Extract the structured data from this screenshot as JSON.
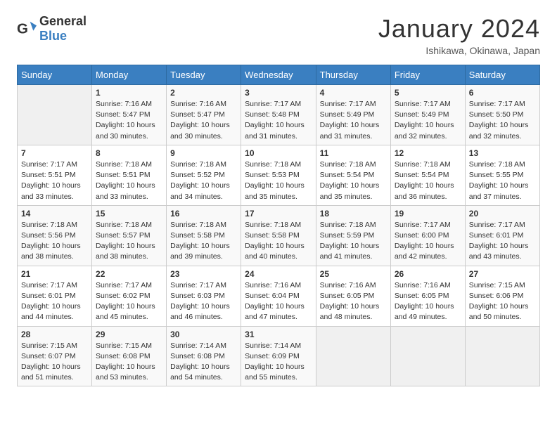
{
  "header": {
    "logo": {
      "general": "General",
      "blue": "Blue"
    },
    "title": "January 2024",
    "location": "Ishikawa, Okinawa, Japan"
  },
  "weekdays": [
    "Sunday",
    "Monday",
    "Tuesday",
    "Wednesday",
    "Thursday",
    "Friday",
    "Saturday"
  ],
  "weeks": [
    [
      {
        "day": null
      },
      {
        "day": "1",
        "sunrise": "7:16 AM",
        "sunset": "5:47 PM",
        "daylight": "10 hours and 30 minutes."
      },
      {
        "day": "2",
        "sunrise": "7:16 AM",
        "sunset": "5:47 PM",
        "daylight": "10 hours and 30 minutes."
      },
      {
        "day": "3",
        "sunrise": "7:17 AM",
        "sunset": "5:48 PM",
        "daylight": "10 hours and 31 minutes."
      },
      {
        "day": "4",
        "sunrise": "7:17 AM",
        "sunset": "5:49 PM",
        "daylight": "10 hours and 31 minutes."
      },
      {
        "day": "5",
        "sunrise": "7:17 AM",
        "sunset": "5:49 PM",
        "daylight": "10 hours and 32 minutes."
      },
      {
        "day": "6",
        "sunrise": "7:17 AM",
        "sunset": "5:50 PM",
        "daylight": "10 hours and 32 minutes."
      }
    ],
    [
      {
        "day": "7",
        "sunrise": "7:17 AM",
        "sunset": "5:51 PM",
        "daylight": "10 hours and 33 minutes."
      },
      {
        "day": "8",
        "sunrise": "7:18 AM",
        "sunset": "5:51 PM",
        "daylight": "10 hours and 33 minutes."
      },
      {
        "day": "9",
        "sunrise": "7:18 AM",
        "sunset": "5:52 PM",
        "daylight": "10 hours and 34 minutes."
      },
      {
        "day": "10",
        "sunrise": "7:18 AM",
        "sunset": "5:53 PM",
        "daylight": "10 hours and 35 minutes."
      },
      {
        "day": "11",
        "sunrise": "7:18 AM",
        "sunset": "5:54 PM",
        "daylight": "10 hours and 35 minutes."
      },
      {
        "day": "12",
        "sunrise": "7:18 AM",
        "sunset": "5:54 PM",
        "daylight": "10 hours and 36 minutes."
      },
      {
        "day": "13",
        "sunrise": "7:18 AM",
        "sunset": "5:55 PM",
        "daylight": "10 hours and 37 minutes."
      }
    ],
    [
      {
        "day": "14",
        "sunrise": "7:18 AM",
        "sunset": "5:56 PM",
        "daylight": "10 hours and 38 minutes."
      },
      {
        "day": "15",
        "sunrise": "7:18 AM",
        "sunset": "5:57 PM",
        "daylight": "10 hours and 38 minutes."
      },
      {
        "day": "16",
        "sunrise": "7:18 AM",
        "sunset": "5:58 PM",
        "daylight": "10 hours and 39 minutes."
      },
      {
        "day": "17",
        "sunrise": "7:18 AM",
        "sunset": "5:58 PM",
        "daylight": "10 hours and 40 minutes."
      },
      {
        "day": "18",
        "sunrise": "7:18 AM",
        "sunset": "5:59 PM",
        "daylight": "10 hours and 41 minutes."
      },
      {
        "day": "19",
        "sunrise": "7:17 AM",
        "sunset": "6:00 PM",
        "daylight": "10 hours and 42 minutes."
      },
      {
        "day": "20",
        "sunrise": "7:17 AM",
        "sunset": "6:01 PM",
        "daylight": "10 hours and 43 minutes."
      }
    ],
    [
      {
        "day": "21",
        "sunrise": "7:17 AM",
        "sunset": "6:01 PM",
        "daylight": "10 hours and 44 minutes."
      },
      {
        "day": "22",
        "sunrise": "7:17 AM",
        "sunset": "6:02 PM",
        "daylight": "10 hours and 45 minutes."
      },
      {
        "day": "23",
        "sunrise": "7:17 AM",
        "sunset": "6:03 PM",
        "daylight": "10 hours and 46 minutes."
      },
      {
        "day": "24",
        "sunrise": "7:16 AM",
        "sunset": "6:04 PM",
        "daylight": "10 hours and 47 minutes."
      },
      {
        "day": "25",
        "sunrise": "7:16 AM",
        "sunset": "6:05 PM",
        "daylight": "10 hours and 48 minutes."
      },
      {
        "day": "26",
        "sunrise": "7:16 AM",
        "sunset": "6:05 PM",
        "daylight": "10 hours and 49 minutes."
      },
      {
        "day": "27",
        "sunrise": "7:15 AM",
        "sunset": "6:06 PM",
        "daylight": "10 hours and 50 minutes."
      }
    ],
    [
      {
        "day": "28",
        "sunrise": "7:15 AM",
        "sunset": "6:07 PM",
        "daylight": "10 hours and 51 minutes."
      },
      {
        "day": "29",
        "sunrise": "7:15 AM",
        "sunset": "6:08 PM",
        "daylight": "10 hours and 53 minutes."
      },
      {
        "day": "30",
        "sunrise": "7:14 AM",
        "sunset": "6:08 PM",
        "daylight": "10 hours and 54 minutes."
      },
      {
        "day": "31",
        "sunrise": "7:14 AM",
        "sunset": "6:09 PM",
        "daylight": "10 hours and 55 minutes."
      },
      {
        "day": null
      },
      {
        "day": null
      },
      {
        "day": null
      }
    ]
  ],
  "labels": {
    "sunrise": "Sunrise:",
    "sunset": "Sunset:",
    "daylight": "Daylight hours"
  }
}
